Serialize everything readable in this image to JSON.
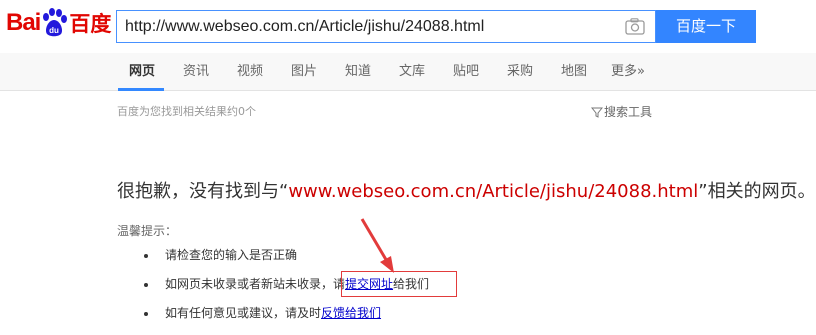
{
  "header": {
    "logo": {
      "bai": "Bai",
      "du": "du",
      "cn": "百度"
    },
    "search": {
      "value": "http://www.webseo.com.cn/Article/jishu/24088.html"
    },
    "search_button": "百度一下",
    "camera_icon": "camera-icon"
  },
  "tabs": [
    {
      "label": "网页",
      "active": true
    },
    {
      "label": "资讯"
    },
    {
      "label": "视频"
    },
    {
      "label": "图片"
    },
    {
      "label": "知道"
    },
    {
      "label": "文库"
    },
    {
      "label": "贴吧"
    },
    {
      "label": "采购"
    },
    {
      "label": "地图"
    },
    {
      "label": "更多»"
    }
  ],
  "result_info": {
    "count": "百度为您找到相关结果约0个",
    "tools": "搜索工具"
  },
  "message": {
    "prefix": "很抱歉，没有找到与“",
    "url": "www.webseo.com.cn/Article/jishu/24088.html",
    "suffix": "”相关的网页。"
  },
  "tips": {
    "title": "温馨提示：",
    "item1": "请检查您的输入是否正确",
    "item2_pre": "如网页未收录或者新站未收录，请",
    "item2_link": "提交网址",
    "item2_post": "给我们",
    "item3_pre": "如有任何意见或建议，请及时",
    "item3_link": "反馈给我们"
  },
  "colors": {
    "brand_red": "#e10602",
    "accent_blue": "#3385ff",
    "query_red": "#c00",
    "annotation_red": "#e23b3b"
  }
}
